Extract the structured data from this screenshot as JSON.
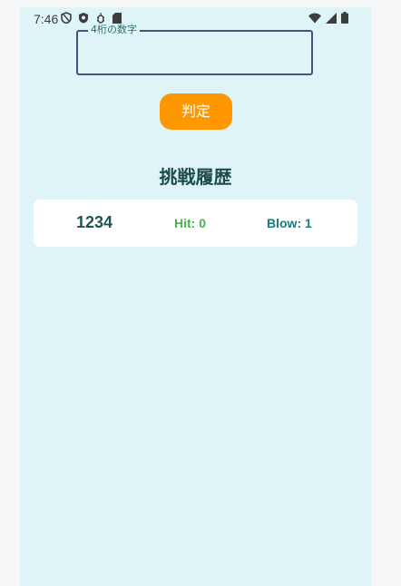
{
  "status_bar": {
    "time": "7:46",
    "left_icons": [
      "shield-outline-icon",
      "shield-icon",
      "debug-icon",
      "sd-card-icon"
    ],
    "right_icons": [
      "wifi-icon",
      "signal-icon",
      "battery-icon"
    ]
  },
  "input": {
    "label": "4桁の数字",
    "value": ""
  },
  "judge_button": {
    "label": "判定"
  },
  "history": {
    "title": "挑戦履歴",
    "entries": [
      {
        "guess": "1234",
        "hit": "Hit: 0",
        "blow": "Blow: 1"
      }
    ]
  },
  "colors": {
    "background": "#dff4f7",
    "accent_button": "#ff9800",
    "hit": "#4caf50",
    "blow": "#1a7a7a",
    "title": "#1c4b4b"
  }
}
